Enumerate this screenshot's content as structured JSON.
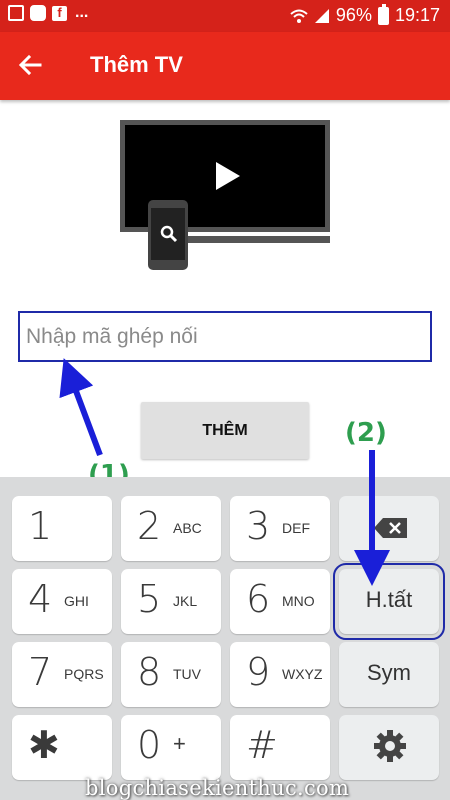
{
  "status_bar": {
    "wifi_icon": "wifi-icon",
    "signal_icon": "signal-icon",
    "battery": "96%",
    "time": "19:17",
    "more": "..."
  },
  "app_bar": {
    "back_icon": "arrow-left-icon",
    "title": "Thêm TV"
  },
  "illustration": {
    "tv_icon": "tv-play-icon",
    "phone_icon": "phone-search-icon"
  },
  "pairing": {
    "placeholder": "Nhập mã ghép nối",
    "value": ""
  },
  "add_button": {
    "label": "THÊM"
  },
  "annotations": {
    "label_1": "(1)",
    "label_2": "(2)",
    "color_arrow": "#1a1fd8",
    "color_label": "#2e9e4f"
  },
  "keypad": {
    "keys": [
      {
        "main": "1",
        "sub": ""
      },
      {
        "main": "2",
        "sub": "ABC"
      },
      {
        "main": "3",
        "sub": "DEF"
      },
      {
        "main": "4",
        "sub": "GHI"
      },
      {
        "main": "5",
        "sub": "JKL"
      },
      {
        "main": "6",
        "sub": "MNO"
      },
      {
        "main": "7",
        "sub": "PQRS"
      },
      {
        "main": "8",
        "sub": "TUV"
      },
      {
        "main": "9",
        "sub": "WXYZ"
      },
      {
        "main": "0",
        "sub": "+"
      },
      {
        "main": "#",
        "sub": ""
      }
    ],
    "star": "✱",
    "done_label": "H.tất",
    "sym_label": "Sym",
    "delete_icon": "backspace-icon",
    "settings_icon": "gear-icon"
  },
  "watermark": "blogchiasekienthuc.com",
  "colors": {
    "status_bar": "#d5221a",
    "app_bar": "#e8291c",
    "highlight_box": "#1f2aa8"
  }
}
